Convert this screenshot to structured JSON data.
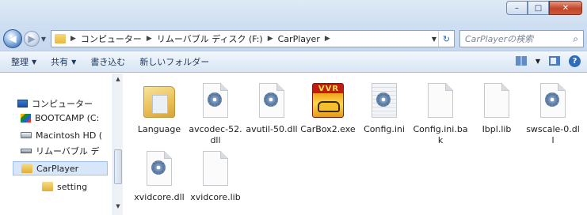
{
  "window": {
    "controls": {
      "minimize": "–",
      "maximize": "□",
      "close": "✕"
    }
  },
  "address_bar": {
    "breadcrumbs": [
      "コンピューター",
      "リムーバブル ディスク (F:)",
      "CarPlayer"
    ],
    "search_placeholder": "CarPlayerの検索"
  },
  "toolbar": {
    "organize": "整理",
    "share": "共有",
    "burn": "書き込む",
    "new_folder": "新しいフォルダー"
  },
  "nav_pane": {
    "items": [
      {
        "label": "コンピューター",
        "icon": "computer-icon"
      },
      {
        "label": "BOOTCAMP (C:",
        "icon": "bootcamp-drive-icon"
      },
      {
        "label": "Macintosh HD (",
        "icon": "hard-drive-icon"
      },
      {
        "label": "リムーバブル デ",
        "icon": "removable-drive-icon"
      },
      {
        "label": "CarPlayer",
        "icon": "folder-icon",
        "selected": true
      },
      {
        "label": "setting",
        "icon": "folder-icon"
      }
    ]
  },
  "files": [
    {
      "name": "Language",
      "type": "folder"
    },
    {
      "name": "avcodec-52.dll",
      "type": "dll"
    },
    {
      "name": "avutil-50.dll",
      "type": "dll"
    },
    {
      "name": "CarBox2.exe",
      "type": "exe",
      "logo_text": "VVR"
    },
    {
      "name": "Config.ini",
      "type": "ini"
    },
    {
      "name": "Config.ini.bak",
      "type": "file"
    },
    {
      "name": "Ibpl.lib",
      "type": "file"
    },
    {
      "name": "swscale-0.dll",
      "type": "dll"
    },
    {
      "name": "xvidcore.dll",
      "type": "dll"
    },
    {
      "name": "xvidcore.lib",
      "type": "file"
    }
  ]
}
